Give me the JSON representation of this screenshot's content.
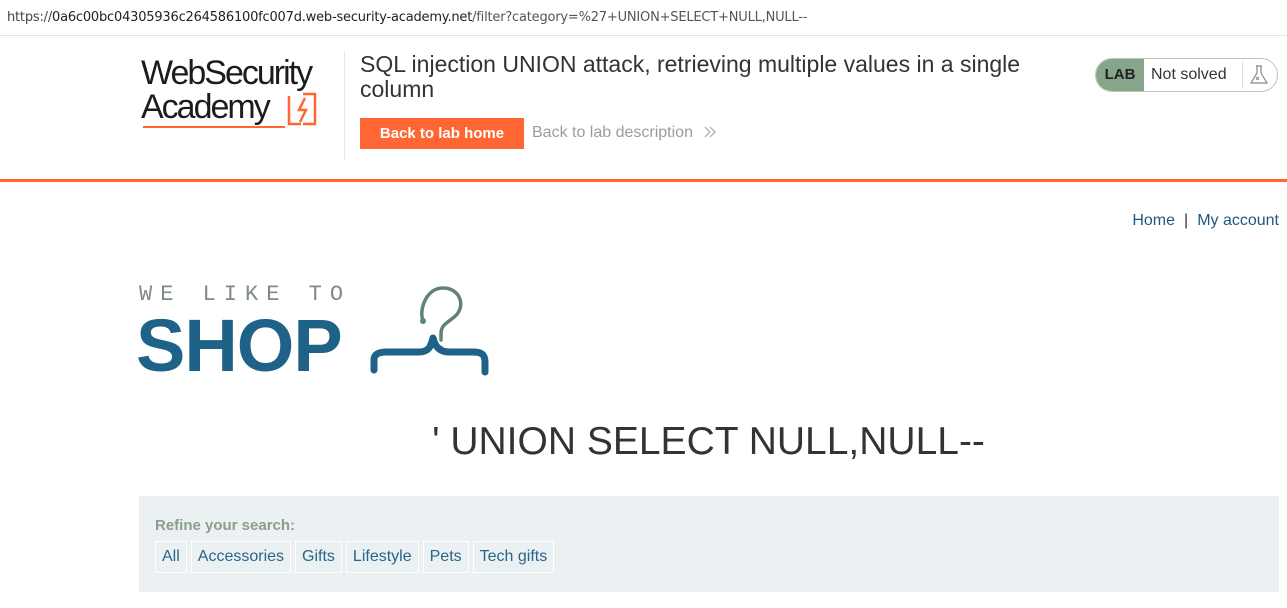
{
  "browser": {
    "url_prefix": "https://",
    "url_host": "0a6c00bc04305936c264586100fc007d.web-security-academy.net",
    "url_path": "/filter?category=%27+UNION+SELECT+NULL,NULL--"
  },
  "academy": {
    "logo_line1": "WebSecurity",
    "logo_line2": "Academy",
    "lab_title": "SQL injection UNION attack, retrieving multiple values in a single column",
    "back_home_label": "Back to lab home",
    "back_description_label": "Back to lab description",
    "status_tag": "LAB",
    "status_text": "Not solved",
    "accent_color": "#ff6633"
  },
  "shop": {
    "nav": {
      "home": "Home",
      "separator": "|",
      "account": "My account"
    },
    "logo_tagline": "WE LIKE TO",
    "logo_word": "SHOP",
    "category_title": "' UNION SELECT NULL,NULL--",
    "refine_label": "Refine your search:",
    "filters": [
      "All",
      "Accessories",
      "Gifts",
      "Lifestyle",
      "Pets",
      "Tech gifts"
    ]
  }
}
